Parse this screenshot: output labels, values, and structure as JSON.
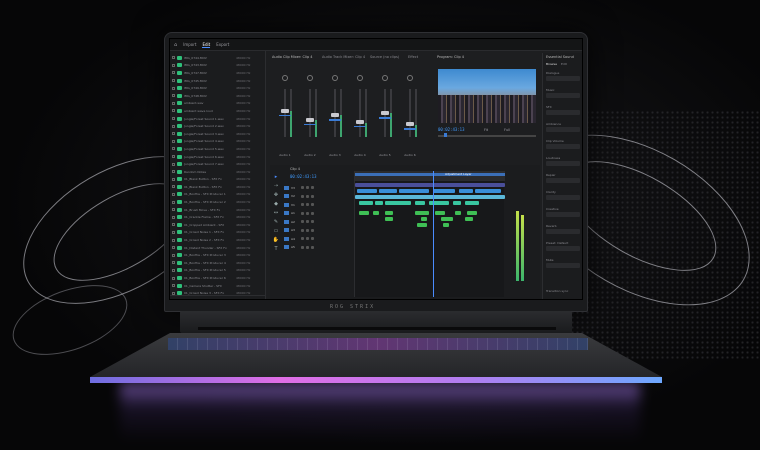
{
  "app": {
    "workspace_tabs": [
      "Import",
      "Edit",
      "Export"
    ],
    "active_tab": "Edit"
  },
  "project": {
    "items": [
      {
        "name": "IMG_0744.MOV",
        "fr": "48000 Hz"
      },
      {
        "name": "IMG_0743.MOV",
        "fr": "48000 Hz"
      },
      {
        "name": "IMG_0747.MOV",
        "fr": "48000 Hz"
      },
      {
        "name": "IMG_0745.MOV",
        "fr": "48000 Hz"
      },
      {
        "name": "IMG_0749.MOV",
        "fr": "48000 Hz"
      },
      {
        "name": "IMG_0748.MOV",
        "fr": "48000 Hz"
      },
      {
        "name": "ambient.wav",
        "fr": "48000 Hz"
      },
      {
        "name": "ambient wave loud",
        "fr": "48000 Hz"
      },
      {
        "name": "Jungle/Forest Sound 1.wav",
        "fr": "48000 Hz"
      },
      {
        "name": "Jungle/Forest Sound 2.wav",
        "fr": "48000 Hz"
      },
      {
        "name": "Jungle/Forest Sound 3.wav",
        "fr": "48000 Hz"
      },
      {
        "name": "Jungle/Forest Sound 4.wav",
        "fr": "48000 Hz"
      },
      {
        "name": "Jungle/Forest Sound 5.wav",
        "fr": "48000 Hz"
      },
      {
        "name": "Jungle/Forest Sound 6.wav",
        "fr": "48000 Hz"
      },
      {
        "name": "Jungle/Forest Sound 7.wav",
        "fr": "48000 Hz"
      },
      {
        "name": "Random Notes",
        "fr": "48000 Hz"
      },
      {
        "name": "01_Blank Button - SFX Fx",
        "fr": "48000 Hz"
      },
      {
        "name": "01_Blank Button - SFX Fx",
        "fr": "48000 Hz"
      },
      {
        "name": "01_Bonfire - SFX Producer 1",
        "fr": "48000 Hz"
      },
      {
        "name": "01_Bonfire - SFX Producer 2",
        "fr": "48000 Hz"
      },
      {
        "name": "01_Brush Move - SFX Fx",
        "fr": "48000 Hz"
      },
      {
        "name": "01_Crackle Flame - SFX Fx",
        "fr": "48000 Hz"
      },
      {
        "name": "01_Cropped Ambient - SFX",
        "fr": "48000 Hz"
      },
      {
        "name": "01_Crowd Noise 1 - SFX Fx",
        "fr": "48000 Hz"
      },
      {
        "name": "01_Crowd Noise 2 - SFX Fx",
        "fr": "48000 Hz"
      },
      {
        "name": "01_Distant Thunder - SFX Fx",
        "fr": "48000 Hz"
      },
      {
        "name": "01_Bonfire - SFX Producer 3",
        "fr": "48000 Hz"
      },
      {
        "name": "01_Bonfire - SFX Producer 4",
        "fr": "48000 Hz"
      },
      {
        "name": "01_Bonfire - SFX Producer 5",
        "fr": "48000 Hz"
      },
      {
        "name": "01_Bonfire - SFX Producer 6",
        "fr": "48000 Hz"
      },
      {
        "name": "01_Camera Shutter - SFX",
        "fr": "48000 Hz"
      },
      {
        "name": "01_Crowd Noise 3 - SFX Fx",
        "fr": "48000 Hz"
      }
    ]
  },
  "mixer": {
    "title_1": "Audio Clip Mixer: Clip 4",
    "title_2": "Audio Track Mixer: Clip 4",
    "title_3": "Source (no clips)",
    "title_4": "Effect",
    "channels": [
      {
        "label": "Audio 1",
        "level": 0.55
      },
      {
        "label": "Audio 2",
        "level": 0.35
      },
      {
        "label": "Audio 3",
        "level": 0.45
      },
      {
        "label": "Audio 4",
        "level": 0.3
      },
      {
        "label": "Audio 5",
        "level": 0.5
      },
      {
        "label": "Audio 6",
        "level": 0.25
      }
    ]
  },
  "program": {
    "title": "Program: Clip 4",
    "timecode": "00:02:43:13",
    "fit": "Fit",
    "quality": "Full"
  },
  "timeline": {
    "title": "Clip 4",
    "timecode": "00:02:43:13",
    "tracks": [
      "V3",
      "V2",
      "V1",
      "A1",
      "A2",
      "A3",
      "A4",
      "A5"
    ],
    "clip_label": "Adjustment Layer"
  },
  "essential": {
    "title": "Essential Sound",
    "tabs": [
      "Browse",
      "Edit"
    ],
    "rows": [
      "Dialogue",
      "Music",
      "SFX",
      "Ambience",
      "Clip Volume",
      "Loudness",
      "Repair",
      "Clarity",
      "Creative",
      "Reverb",
      "Preset: Default",
      "Mute"
    ],
    "checkbox": "Transition sync"
  },
  "laptop": {
    "brand": "ROG STRIX"
  }
}
